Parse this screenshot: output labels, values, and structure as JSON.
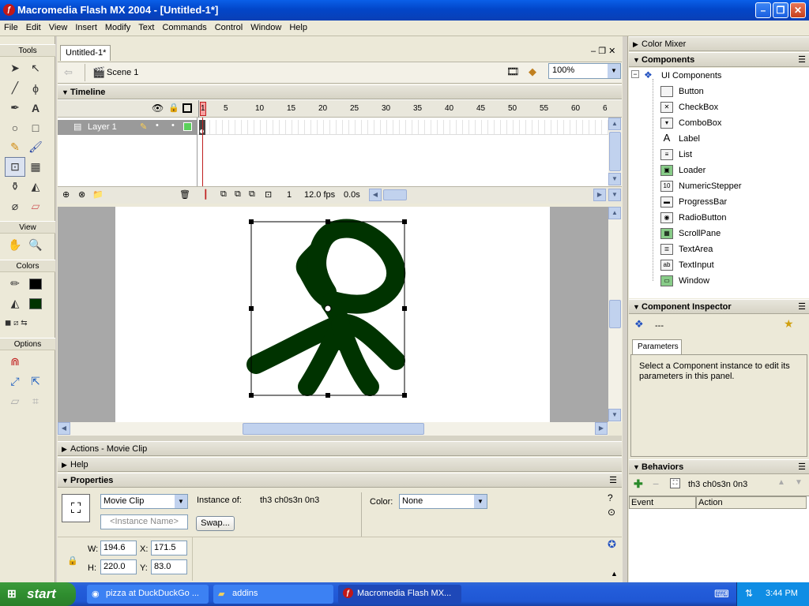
{
  "window": {
    "title": "Macromedia Flash MX 2004 - [Untitled-1*]"
  },
  "menu": [
    "File",
    "Edit",
    "View",
    "Insert",
    "Modify",
    "Text",
    "Commands",
    "Control",
    "Window",
    "Help"
  ],
  "tools": {
    "title": "Tools",
    "view": "View",
    "colors": "Colors",
    "options": "Options"
  },
  "document": {
    "tab": "Untitled-1*",
    "scene": "Scene 1",
    "zoom": "100%"
  },
  "timeline": {
    "title": "Timeline",
    "layer": "Layer 1",
    "frame_numbers": [
      "1",
      "5",
      "10",
      "15",
      "20",
      "25",
      "30",
      "35",
      "40",
      "45",
      "50",
      "55",
      "60",
      "6"
    ],
    "current_frame": "1",
    "fps": "12.0 fps",
    "time": "0.0s"
  },
  "panels": {
    "actions": "Actions - Movie Clip",
    "help": "Help",
    "properties": "Properties"
  },
  "properties": {
    "symbol_type": "Movie Clip",
    "instance_name_placeholder": "<Instance Name>",
    "instance_of_label": "Instance of:",
    "instance_of_value": "th3 ch0s3n 0n3",
    "swap_label": "Swap...",
    "color_label": "Color:",
    "color_value": "None",
    "w_label": "W:",
    "w": "194.6",
    "h_label": "H:",
    "h": "220.0",
    "x_label": "X:",
    "x": "171.5",
    "y_label": "Y:",
    "y": "83.0"
  },
  "right": {
    "color_mixer": "Color Mixer",
    "components": "Components",
    "ui_components": "UI Components",
    "items": [
      "Button",
      "CheckBox",
      "ComboBox",
      "Label",
      "List",
      "Loader",
      "NumericStepper",
      "ProgressBar",
      "RadioButton",
      "ScrollPane",
      "TextArea",
      "TextInput",
      "Window"
    ],
    "inspector": "Component Inspector",
    "inspector_value": "---",
    "parameters_tab": "Parameters",
    "inspector_msg": "Select a Component instance to edit its parameters in this panel.",
    "behaviors": "Behaviors",
    "behaviors_target": "th3 ch0s3n 0n3",
    "event_col": "Event",
    "action_col": "Action"
  },
  "taskbar": {
    "start": "start",
    "tasks": [
      "pizza at DuckDuckGo ...",
      "addins",
      "Macromedia Flash MX..."
    ],
    "time": "3:44 PM"
  },
  "colors": {
    "stroke": "#000000",
    "fill": "#003300",
    "accent": "#0a5fe8"
  }
}
